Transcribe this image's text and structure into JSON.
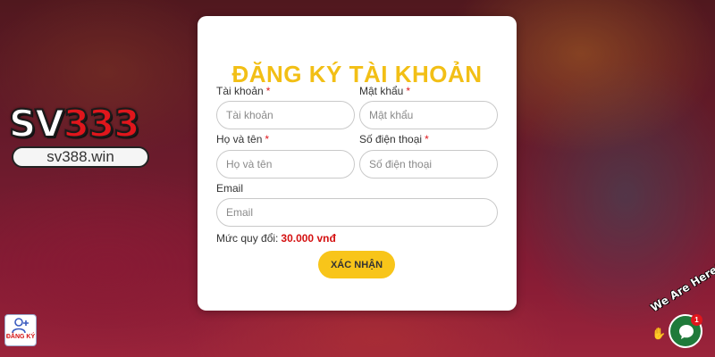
{
  "brand": {
    "logo_text_part1": "SV",
    "logo_text_part2": "333",
    "domain": "sv388.win"
  },
  "form": {
    "title": "ĐĂNG KÝ TÀI KHOẢN",
    "fields": [
      {
        "label": "Tài khoản",
        "required_mark": "*",
        "placeholder": "Tài khoản",
        "value": ""
      },
      {
        "label": "Mật khẩu",
        "required_mark": "*",
        "placeholder": "Mật khẩu",
        "value": ""
      },
      {
        "label": "Họ và tên",
        "required_mark": "*",
        "placeholder": "Họ và tên",
        "value": ""
      },
      {
        "label": "Số điện thoại",
        "required_mark": "*",
        "placeholder": "Số điện thoại",
        "value": ""
      },
      {
        "label": "Email",
        "placeholder": "Email",
        "value": ""
      }
    ],
    "rate_label": "Mức quy đổi:",
    "rate_value": "30.000 vnđ",
    "submit_label": "XÁC NHẬN"
  },
  "register_button": {
    "label": "ĐĂNG KÝ",
    "icon": "add-user-icon"
  },
  "chat_widget": {
    "caption": "We Are Here!",
    "badge_count": "1",
    "icon": "chat-bubble-icon",
    "wave_icon": "waving-hand-icon"
  },
  "colors": {
    "accent_yellow": "#f2bf16",
    "button_yellow": "#f8c51a",
    "required_red": "#e0161c",
    "rate_red": "#d41111",
    "chat_green": "#1f7a3a"
  }
}
